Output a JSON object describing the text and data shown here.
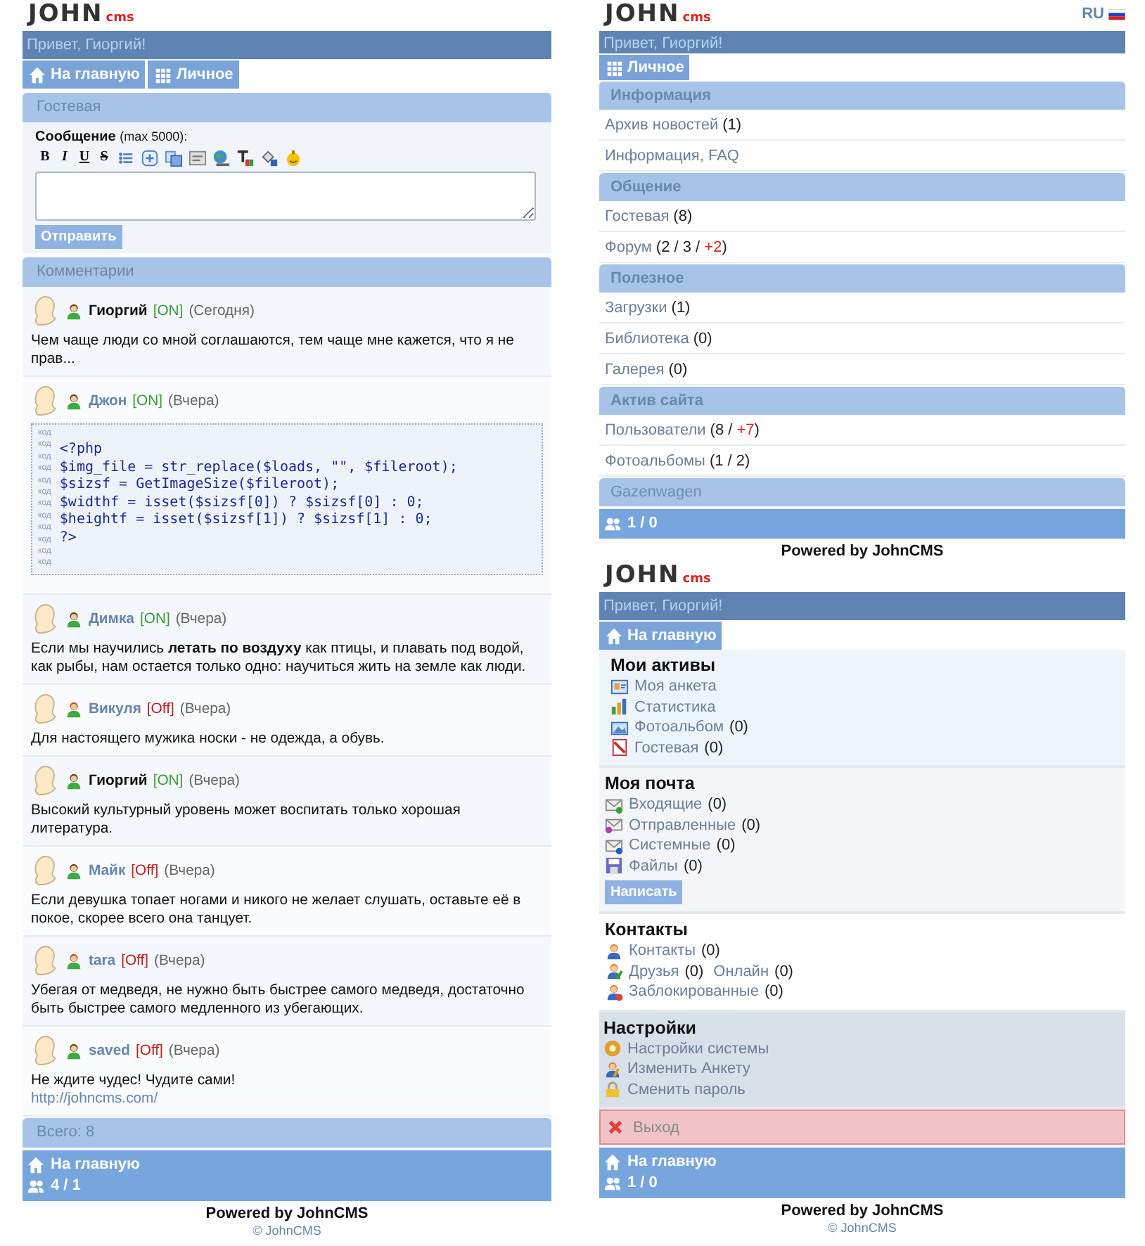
{
  "left": {
    "logo": {
      "main": "JOHN",
      "sub": "cms"
    },
    "greeting": "Привет, Гиоргий!",
    "tabs": [
      {
        "kind": "home",
        "label": "На главную"
      },
      {
        "kind": "grid",
        "label": "Личное"
      }
    ],
    "title": "Гостевая",
    "form": {
      "label": "Сообщение",
      "hint": "(max 5000):",
      "submit": "Отправить",
      "toolbar": [
        {
          "kind": "bold",
          "label": "B"
        },
        {
          "kind": "italic",
          "label": "I"
        },
        {
          "kind": "underline",
          "label": "U"
        },
        {
          "kind": "strike",
          "label": "S"
        },
        {
          "kind": "list"
        },
        {
          "kind": "plus"
        },
        {
          "kind": "copy"
        },
        {
          "kind": "php"
        },
        {
          "kind": "globe"
        },
        {
          "kind": "textcolor"
        },
        {
          "kind": "paint"
        },
        {
          "kind": "smile"
        }
      ]
    },
    "comments_title": "Комментарии",
    "comments": [
      {
        "kind": "male",
        "name": "Гиоргий",
        "own": true,
        "status": "[ON]",
        "online": true,
        "time": "(Сегодня)",
        "text": "Чем чаще люди со мной соглашаются, тем чаще мне кажется, что я не прав..."
      },
      {
        "kind": "male",
        "name": "Джон",
        "own": false,
        "status": "[ON]",
        "online": true,
        "time": "(Вчера)",
        "code": {
          "gutter": [
            "код",
            "код",
            "код",
            "код",
            "код",
            "код",
            "код",
            "код",
            "код",
            "код",
            "код",
            "код"
          ],
          "lines": [
            "<?php",
            "$img_file = str_replace($loads, \"\", $fileroot);",
            "$sizsf = GetImageSize($fileroot);",
            "$widthf = isset($sizsf[0]) ? $sizsf[0] : 0;",
            "$heightf = isset($sizsf[1]) ? $sizsf[1] : 0;",
            "?>"
          ]
        }
      },
      {
        "kind": "male",
        "name": "Димка",
        "own": false,
        "status": "[ON]",
        "online": true,
        "time": "(Вчера)",
        "text": "Если мы научились **летать по воздуху** как птицы, и плавать под водой, как рыбы, нам остается только одно: научиться жить на земле как люди."
      },
      {
        "kind": "female",
        "name": "Викуля",
        "own": false,
        "status": "[Off]",
        "online": false,
        "time": "(Вчера)",
        "text": "Для настоящего мужика носки - не одежда, а обувь."
      },
      {
        "kind": "male",
        "name": "Гиоргий",
        "own": true,
        "status": "[ON]",
        "online": true,
        "time": "(Вчера)",
        "text": "Высокий культурный уровень может воспитать только хорошая литература."
      },
      {
        "kind": "male",
        "name": "Майк",
        "own": false,
        "status": "[Off]",
        "online": false,
        "time": "(Вчера)",
        "text": "Если девушка топает ногами и никого не желает слушать, оставьте её в покое, скорее всего она танцует."
      },
      {
        "kind": "female",
        "name": "tara",
        "own": false,
        "status": "[Off]",
        "online": false,
        "time": "(Вчера)",
        "text": "Убегая от медведя, не нужно быть быстрее самого медведя, достаточно быть быстрее самого медленного из убегающих."
      },
      {
        "kind": "male",
        "name": "saved",
        "own": false,
        "status": "[Off]",
        "online": false,
        "time": "(Вчера)",
        "text": "Не ждите чудес! Чудите сами!",
        "link": "http://johncms.com/"
      }
    ],
    "total": "Всего: 8",
    "footer": {
      "home": "На главную",
      "online": "4 / 1"
    },
    "powered": "Powered by JohnCMS",
    "copyright": "© JohnCMS"
  },
  "menu": {
    "logo": {
      "main": "JOHN",
      "sub": "cms"
    },
    "lang": {
      "label": "RU",
      "selected": true
    },
    "greeting": "Привет, Гиоргий!",
    "tab": {
      "kind": "grid",
      "label": "Личное"
    },
    "sections": [
      {
        "title": "Информация",
        "muted": false,
        "items": [
          {
            "label": "Архив новостей",
            "count": [
              {
                "t": "(1)",
                "new": false
              }
            ]
          },
          {
            "label": "Информация, FAQ"
          }
        ]
      },
      {
        "title": "Общение",
        "muted": false,
        "items": [
          {
            "label": "Гостевая",
            "count": [
              {
                "t": "(8)",
                "new": false
              }
            ]
          },
          {
            "label": "Форум",
            "count": [
              {
                "t": "(2 / 3 / ",
                "new": false
              },
              {
                "t": "+2",
                "new": true
              },
              {
                "t": ")",
                "new": false
              }
            ]
          }
        ]
      },
      {
        "title": "Полезное",
        "muted": false,
        "items": [
          {
            "label": "Загрузки",
            "count": [
              {
                "t": "(1)",
                "new": false
              }
            ]
          },
          {
            "label": "Библиотека",
            "count": [
              {
                "t": "(0)",
                "new": false
              }
            ]
          },
          {
            "label": "Галерея",
            "count": [
              {
                "t": "(0)",
                "new": false
              }
            ]
          }
        ]
      },
      {
        "title": "Актив сайта",
        "muted": false,
        "items": [
          {
            "label": "Пользователи",
            "count": [
              {
                "t": "(8 / ",
                "new": false
              },
              {
                "t": "+7",
                "new": true
              },
              {
                "t": ")",
                "new": false
              }
            ]
          },
          {
            "label": "Фотоальбомы",
            "count": [
              {
                "t": "(1 / 2)",
                "new": false
              }
            ]
          }
        ]
      },
      {
        "title": "Gazenwagen",
        "muted": true
      }
    ],
    "online": "1 / 0",
    "powered": "Powered by JohnCMS"
  },
  "cabinet": {
    "logo": {
      "main": "JOHN",
      "sub": "cms"
    },
    "greeting": "Привет, Гиоргий!",
    "tab": {
      "kind": "home",
      "label": "На главную"
    },
    "groups": [
      {
        "title": "Мои активы",
        "kind": "light",
        "items": [
          {
            "kind": "card",
            "label": "Моя анкета"
          },
          {
            "kind": "chart",
            "label": "Статистика"
          },
          {
            "kind": "photo",
            "label": "Фотоальбом",
            "count": "(0)"
          },
          {
            "kind": "book",
            "label": "Гостевая",
            "count": "(0)"
          }
        ]
      },
      {
        "title": "Моя почта",
        "kind": "gray",
        "button": "Написать",
        "items": [
          {
            "kind": "inbox",
            "label": "Входящие",
            "count": "(0)"
          },
          {
            "kind": "outbox",
            "label": "Отправленные",
            "count": "(0)"
          },
          {
            "kind": "system",
            "label": "Системные",
            "count": "(0)"
          },
          {
            "kind": "floppy",
            "label": "Файлы",
            "count": "(0)"
          }
        ]
      },
      {
        "title": "Контакты",
        "kind": "plain",
        "items": [
          {
            "kind": "person",
            "label": "Контакты",
            "count": "(0)"
          },
          {
            "kind": "friends",
            "label": "Друзья",
            "count": "(0)",
            "extra": "Онлайн",
            "extra_count": "(0)"
          },
          {
            "kind": "blocked",
            "label": "Заблокированные",
            "count": "(0)"
          }
        ]
      },
      {
        "title": "Настройки",
        "kind": "dark",
        "items": [
          {
            "kind": "gear",
            "label": "Настройки системы"
          },
          {
            "kind": "edit",
            "label": "Изменить Анкету"
          },
          {
            "kind": "lock",
            "label": "Сменить пароль"
          }
        ]
      }
    ],
    "exit": "Выход",
    "footer": {
      "home": "На главную",
      "online": "1 / 0"
    },
    "powered": "Powered by JohnCMS",
    "copyright": "© JohnCMS"
  }
}
